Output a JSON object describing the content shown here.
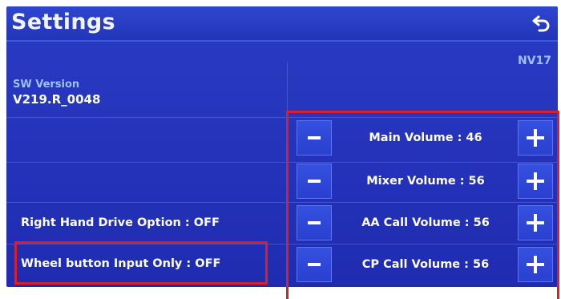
{
  "header": {
    "title": "Settings",
    "back_icon": "back-arrow-icon"
  },
  "model": "NV17",
  "sw_version": {
    "label": "SW Version",
    "value": "V219.R_0048"
  },
  "options": [
    {
      "label": "Right Hand Drive Option : OFF"
    },
    {
      "label": "Wheel button Input Only : OFF"
    }
  ],
  "volumes": [
    {
      "label": "Main Volume : 46",
      "value": 46
    },
    {
      "label": "Mixer Volume : 56",
      "value": 56
    },
    {
      "label": "AA Call Volume : 56",
      "value": 56
    },
    {
      "label": "CP Call Volume : 56",
      "value": 56
    }
  ],
  "colors": {
    "background": "#2534bb",
    "highlight": "#d9202a",
    "text": "#ffffff",
    "label_accent": "#9fc0ff"
  }
}
